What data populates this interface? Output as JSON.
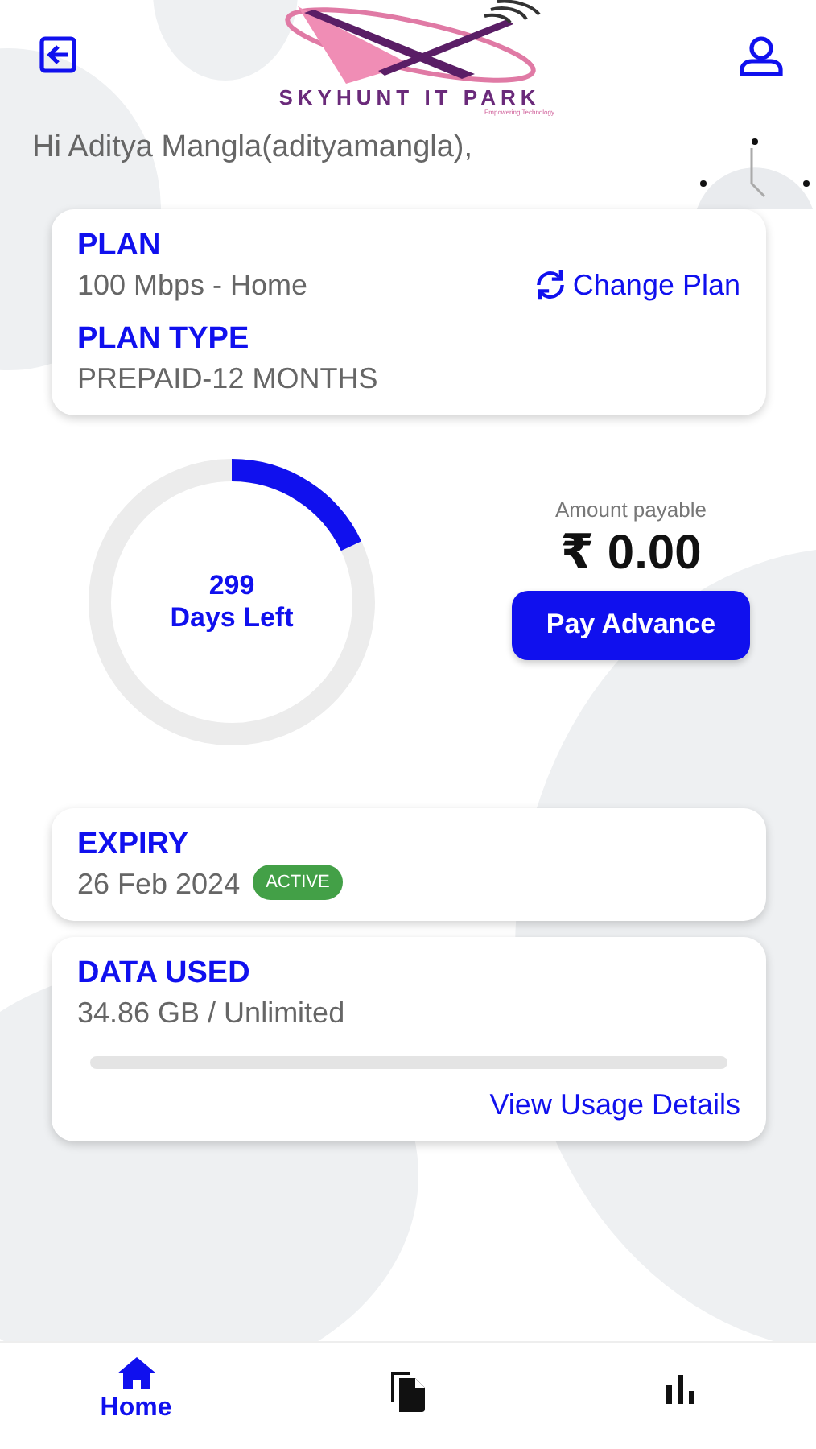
{
  "header": {
    "logo_text": "SKYHUNT IT PARK",
    "logo_tagline": "Empowering Technology"
  },
  "greeting": "Hi Aditya Mangla(adityamangla),",
  "plan_card": {
    "plan_label": "PLAN",
    "plan_value": "100 Mbps - Home",
    "change_plan": "Change Plan",
    "type_label": "PLAN TYPE",
    "type_value": "PREPAID-12 MONTHS"
  },
  "days": {
    "count": "299",
    "label": "Days Left",
    "level": 0.18
  },
  "payment": {
    "label": "Amount payable",
    "amount": "₹ 0.00",
    "button": "Pay Advance"
  },
  "expiry_card": {
    "label": "EXPIRY",
    "date": "26 Feb 2024",
    "status": "ACTIVE",
    "active": true
  },
  "data_card": {
    "label": "DATA USED",
    "value": "34.86 GB / Unlimited",
    "level": 0,
    "link": "View Usage Details"
  },
  "bottom_nav": [
    {
      "kind": "home",
      "label": "Home",
      "selected": true
    },
    {
      "kind": "documents",
      "selected": false
    },
    {
      "kind": "stats",
      "selected": false
    }
  ]
}
